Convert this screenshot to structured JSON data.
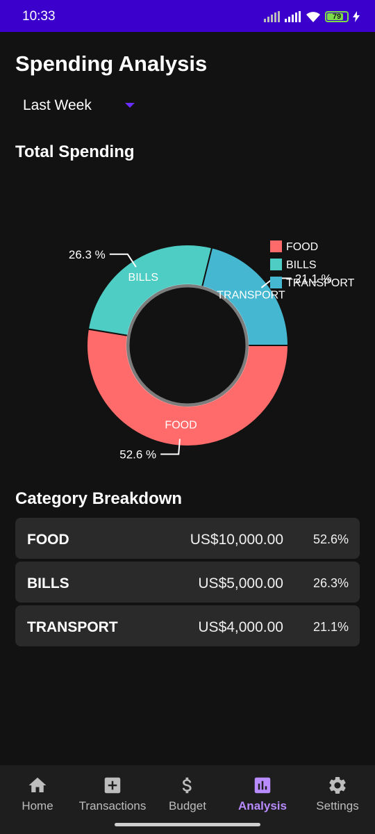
{
  "status_bar": {
    "time": "10:33",
    "battery": "79"
  },
  "header": {
    "title": "Spending Analysis"
  },
  "period_select": {
    "selected": "Last Week"
  },
  "total_section": {
    "title": "Total Spending"
  },
  "chart_data": {
    "type": "pie",
    "categories": [
      "FOOD",
      "BILLS",
      "TRANSPORT"
    ],
    "values": [
      52.6,
      26.3,
      21.1
    ],
    "percent_labels": [
      "52.6 %",
      "26.3 %",
      "21.1 %"
    ],
    "colors": [
      "#ff6b6b",
      "#4ecdc4",
      "#45b7d1"
    ],
    "legend": "top-right",
    "donut": true
  },
  "breakdown": {
    "title": "Category Breakdown",
    "rows": [
      {
        "category": "FOOD",
        "amount": "US$10,000.00",
        "percent": "52.6%"
      },
      {
        "category": "BILLS",
        "amount": "US$5,000.00",
        "percent": "26.3%"
      },
      {
        "category": "TRANSPORT",
        "amount": "US$4,000.00",
        "percent": "21.1%"
      }
    ]
  },
  "nav": {
    "items": [
      {
        "label": "Home",
        "icon": "home-icon"
      },
      {
        "label": "Transactions",
        "icon": "plus-box-icon"
      },
      {
        "label": "Budget",
        "icon": "dollar-icon"
      },
      {
        "label": "Analysis",
        "icon": "bar-chart-icon",
        "active": true
      },
      {
        "label": "Settings",
        "icon": "gear-icon"
      }
    ]
  }
}
